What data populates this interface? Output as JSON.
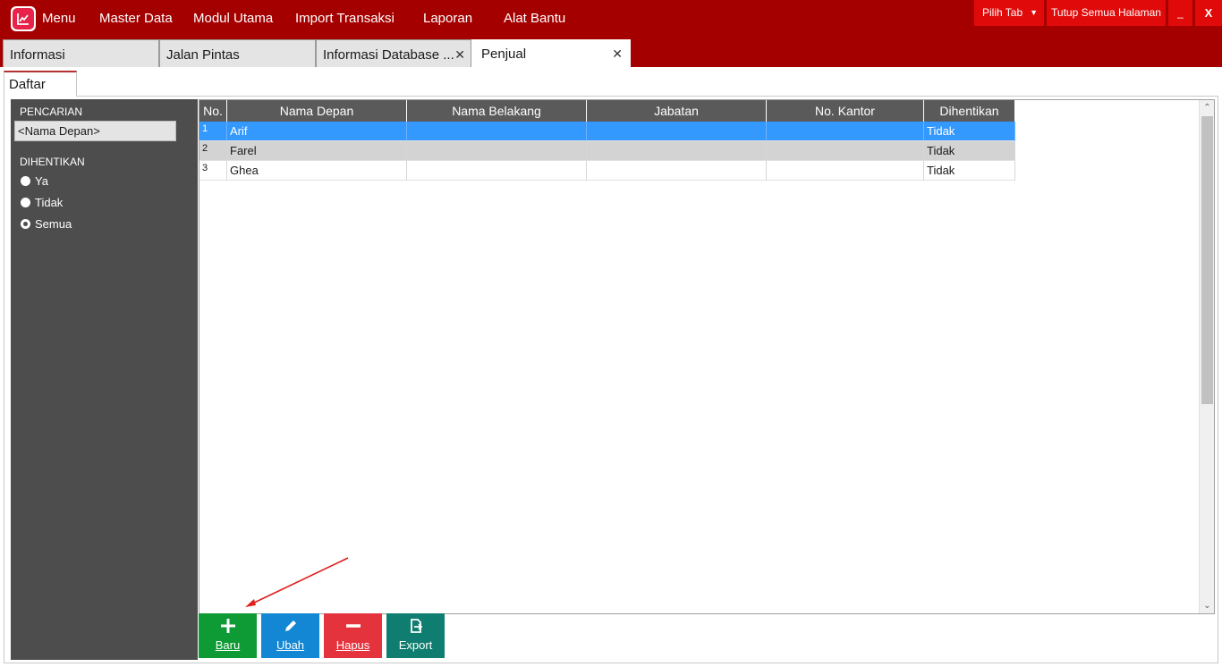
{
  "colors": {
    "brand": "#a50000",
    "top_button": "#e00a0a",
    "sidebar": "#4d4d4d",
    "selected_row": "#3399ff",
    "btn_baru": "#0e9a34",
    "btn_ubah": "#1386d4",
    "btn_hapus": "#e5333d",
    "btn_export": "#0f7d6f",
    "annotation_arrow": "#e0201d"
  },
  "menubar": {
    "items": [
      {
        "label": "Menu"
      },
      {
        "label": "Master Data"
      },
      {
        "label": "Modul Utama"
      },
      {
        "label": "Import Transaksi"
      },
      {
        "label": "Laporan"
      },
      {
        "label": "Alat Bantu"
      }
    ],
    "pilih_tab": "Pilih Tab",
    "tutup_semua": "Tutup Semua Halaman",
    "minimize": "_",
    "close": "X"
  },
  "tabs": [
    {
      "label": "Informasi"
    },
    {
      "label": "Jalan Pintas"
    },
    {
      "label": "Informasi Database ..."
    },
    {
      "label": "Penjual"
    }
  ],
  "subtab": {
    "label": "Daftar"
  },
  "sidebar": {
    "search_title": "PENCARIAN",
    "search_value": "<Nama Depan>",
    "filter_title": "DIHENTIKAN",
    "options": [
      {
        "label": "Ya",
        "checked": false
      },
      {
        "label": "Tidak",
        "checked": false
      },
      {
        "label": "Semua",
        "checked": true
      }
    ]
  },
  "grid": {
    "columns": [
      "No.",
      "Nama Depan",
      "Nama Belakang",
      "Jabatan",
      "No. Kantor",
      "Dihentikan"
    ],
    "rows": [
      {
        "no": "1",
        "nama_depan": "Arif",
        "nama_belakang": "",
        "jabatan": "",
        "no_kantor": "",
        "dihentikan": "Tidak"
      },
      {
        "no": "2",
        "nama_depan": "Farel",
        "nama_belakang": "",
        "jabatan": "",
        "no_kantor": "",
        "dihentikan": "Tidak"
      },
      {
        "no": "3",
        "nama_depan": "Ghea",
        "nama_belakang": "",
        "jabatan": "",
        "no_kantor": "",
        "dihentikan": "Tidak"
      }
    ]
  },
  "actions": [
    {
      "label": "Baru",
      "icon": "plus-icon"
    },
    {
      "label": "Ubah",
      "icon": "pencil-icon"
    },
    {
      "label": "Hapus",
      "icon": "minus-icon"
    },
    {
      "label": "Export",
      "icon": "export-icon"
    }
  ]
}
